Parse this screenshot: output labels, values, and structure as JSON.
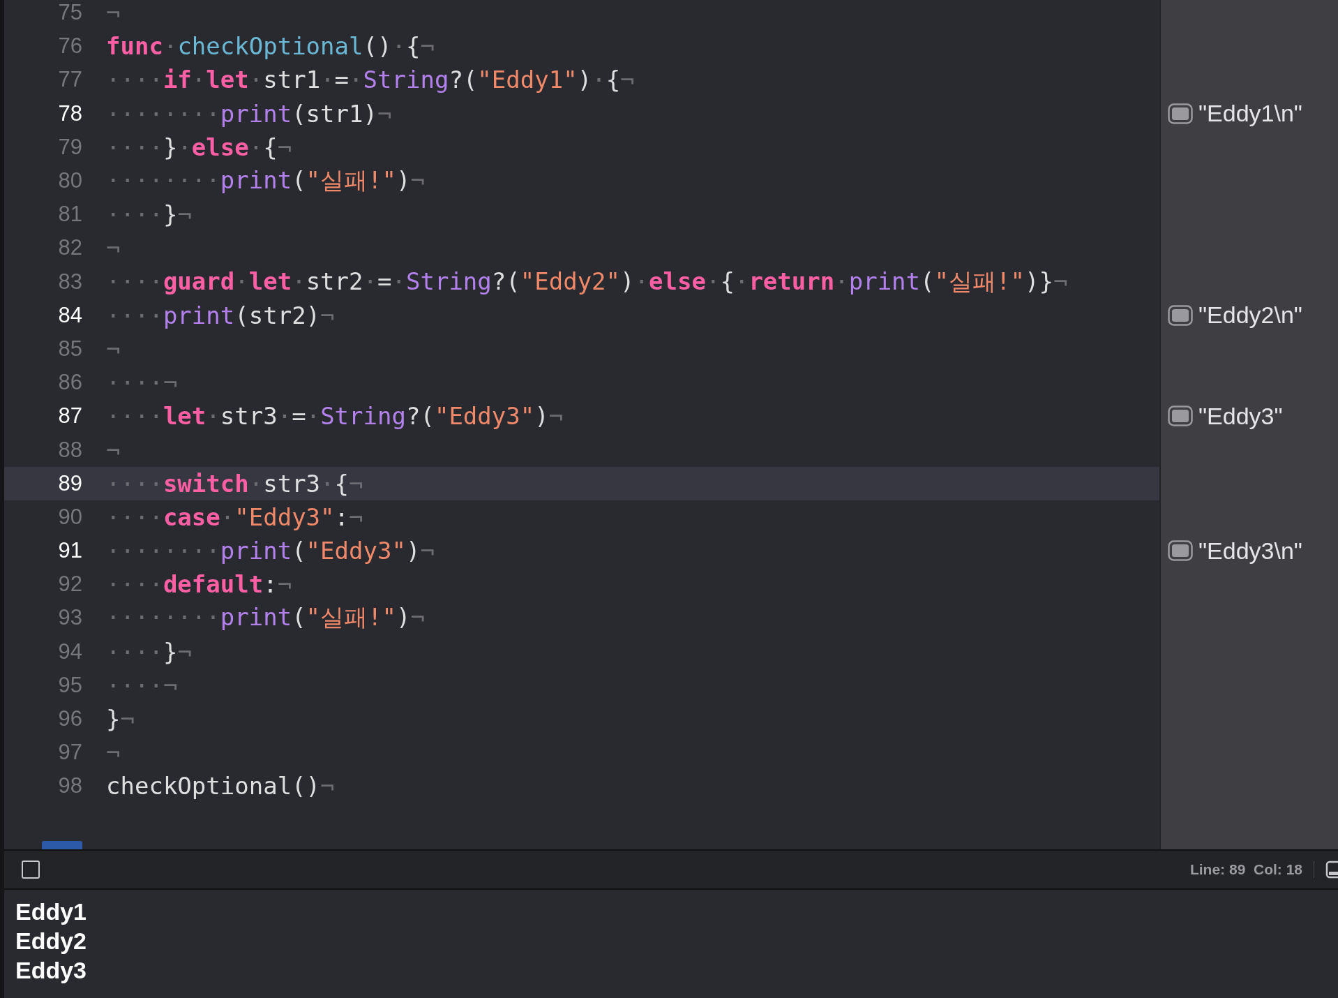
{
  "editor": {
    "lines": [
      {
        "number": "75",
        "emphasized": false,
        "selected": false,
        "tokens": [
          {
            "kind": "ws",
            "text": "¬"
          }
        ]
      },
      {
        "number": "76",
        "emphasized": false,
        "selected": false,
        "tokens": [
          {
            "kind": "kw",
            "text": "func"
          },
          {
            "kind": "ws",
            "text": "·"
          },
          {
            "kind": "decl",
            "text": "checkOptional"
          },
          {
            "kind": "plain",
            "text": "()"
          },
          {
            "kind": "ws",
            "text": "·"
          },
          {
            "kind": "plain",
            "text": "{"
          },
          {
            "kind": "ws",
            "text": "¬"
          }
        ]
      },
      {
        "number": "77",
        "emphasized": false,
        "selected": false,
        "tokens": [
          {
            "kind": "ws",
            "text": "····"
          },
          {
            "kind": "kw",
            "text": "if"
          },
          {
            "kind": "ws",
            "text": "·"
          },
          {
            "kind": "kw",
            "text": "let"
          },
          {
            "kind": "ws",
            "text": "·"
          },
          {
            "kind": "plain",
            "text": "str1"
          },
          {
            "kind": "ws",
            "text": "·"
          },
          {
            "kind": "plain",
            "text": "="
          },
          {
            "kind": "ws",
            "text": "·"
          },
          {
            "kind": "call",
            "text": "String"
          },
          {
            "kind": "plain",
            "text": "?("
          },
          {
            "kind": "str",
            "text": "\"Eddy1\""
          },
          {
            "kind": "plain",
            "text": ")"
          },
          {
            "kind": "ws",
            "text": "·"
          },
          {
            "kind": "plain",
            "text": "{"
          },
          {
            "kind": "ws",
            "text": "¬"
          }
        ]
      },
      {
        "number": "78",
        "emphasized": true,
        "selected": false,
        "result": "\"Eddy1\\n\"",
        "tokens": [
          {
            "kind": "ws",
            "text": "········"
          },
          {
            "kind": "call",
            "text": "print"
          },
          {
            "kind": "plain",
            "text": "(str1)"
          },
          {
            "kind": "ws",
            "text": "¬"
          }
        ]
      },
      {
        "number": "79",
        "emphasized": false,
        "selected": false,
        "tokens": [
          {
            "kind": "ws",
            "text": "····"
          },
          {
            "kind": "plain",
            "text": "}"
          },
          {
            "kind": "ws",
            "text": "·"
          },
          {
            "kind": "kw",
            "text": "else"
          },
          {
            "kind": "ws",
            "text": "·"
          },
          {
            "kind": "plain",
            "text": "{"
          },
          {
            "kind": "ws",
            "text": "¬"
          }
        ]
      },
      {
        "number": "80",
        "emphasized": false,
        "selected": false,
        "tokens": [
          {
            "kind": "ws",
            "text": "········"
          },
          {
            "kind": "call",
            "text": "print"
          },
          {
            "kind": "plain",
            "text": "("
          },
          {
            "kind": "str",
            "text": "\"실패!\""
          },
          {
            "kind": "plain",
            "text": ")"
          },
          {
            "kind": "ws",
            "text": "¬"
          }
        ]
      },
      {
        "number": "81",
        "emphasized": false,
        "selected": false,
        "tokens": [
          {
            "kind": "ws",
            "text": "····"
          },
          {
            "kind": "plain",
            "text": "}"
          },
          {
            "kind": "ws",
            "text": "¬"
          }
        ]
      },
      {
        "number": "82",
        "emphasized": false,
        "selected": false,
        "tokens": [
          {
            "kind": "ws",
            "text": "¬"
          }
        ]
      },
      {
        "number": "83",
        "emphasized": false,
        "selected": false,
        "tokens": [
          {
            "kind": "ws",
            "text": "····"
          },
          {
            "kind": "kw",
            "text": "guard"
          },
          {
            "kind": "ws",
            "text": "·"
          },
          {
            "kind": "kw",
            "text": "let"
          },
          {
            "kind": "ws",
            "text": "·"
          },
          {
            "kind": "plain",
            "text": "str2"
          },
          {
            "kind": "ws",
            "text": "·"
          },
          {
            "kind": "plain",
            "text": "="
          },
          {
            "kind": "ws",
            "text": "·"
          },
          {
            "kind": "call",
            "text": "String"
          },
          {
            "kind": "plain",
            "text": "?("
          },
          {
            "kind": "str",
            "text": "\"Eddy2\""
          },
          {
            "kind": "plain",
            "text": ")"
          },
          {
            "kind": "ws",
            "text": "·"
          },
          {
            "kind": "kw",
            "text": "else"
          },
          {
            "kind": "ws",
            "text": "·"
          },
          {
            "kind": "plain",
            "text": "{"
          },
          {
            "kind": "ws",
            "text": "·"
          },
          {
            "kind": "kw",
            "text": "return"
          },
          {
            "kind": "ws",
            "text": "·"
          },
          {
            "kind": "call",
            "text": "print"
          },
          {
            "kind": "plain",
            "text": "("
          },
          {
            "kind": "str",
            "text": "\"실패!\""
          },
          {
            "kind": "plain",
            "text": ")}"
          },
          {
            "kind": "ws",
            "text": "¬"
          }
        ]
      },
      {
        "number": "84",
        "emphasized": true,
        "selected": false,
        "result": "\"Eddy2\\n\"",
        "tokens": [
          {
            "kind": "ws",
            "text": "····"
          },
          {
            "kind": "call",
            "text": "print"
          },
          {
            "kind": "plain",
            "text": "(str2)"
          },
          {
            "kind": "ws",
            "text": "¬"
          }
        ]
      },
      {
        "number": "85",
        "emphasized": false,
        "selected": false,
        "tokens": [
          {
            "kind": "ws",
            "text": "¬"
          }
        ]
      },
      {
        "number": "86",
        "emphasized": false,
        "selected": false,
        "tokens": [
          {
            "kind": "ws",
            "text": "····¬"
          }
        ]
      },
      {
        "number": "87",
        "emphasized": true,
        "selected": false,
        "result": "\"Eddy3\"",
        "tokens": [
          {
            "kind": "ws",
            "text": "····"
          },
          {
            "kind": "kw",
            "text": "let"
          },
          {
            "kind": "ws",
            "text": "·"
          },
          {
            "kind": "plain",
            "text": "str3"
          },
          {
            "kind": "ws",
            "text": "·"
          },
          {
            "kind": "plain",
            "text": "="
          },
          {
            "kind": "ws",
            "text": "·"
          },
          {
            "kind": "call",
            "text": "String"
          },
          {
            "kind": "plain",
            "text": "?("
          },
          {
            "kind": "str",
            "text": "\"Eddy3\""
          },
          {
            "kind": "plain",
            "text": ")"
          },
          {
            "kind": "ws",
            "text": "¬"
          }
        ]
      },
      {
        "number": "88",
        "emphasized": false,
        "selected": false,
        "tokens": [
          {
            "kind": "ws",
            "text": "¬"
          }
        ]
      },
      {
        "number": "89",
        "emphasized": true,
        "selected": true,
        "tokens": [
          {
            "kind": "ws",
            "text": "····"
          },
          {
            "kind": "kw",
            "text": "switch"
          },
          {
            "kind": "ws",
            "text": "·"
          },
          {
            "kind": "plain",
            "text": "str3"
          },
          {
            "kind": "ws",
            "text": "·"
          },
          {
            "kind": "plain",
            "text": "{"
          },
          {
            "kind": "ws",
            "text": "¬"
          }
        ]
      },
      {
        "number": "90",
        "emphasized": false,
        "selected": false,
        "tokens": [
          {
            "kind": "ws",
            "text": "····"
          },
          {
            "kind": "kw",
            "text": "case"
          },
          {
            "kind": "ws",
            "text": "·"
          },
          {
            "kind": "str",
            "text": "\"Eddy3\""
          },
          {
            "kind": "plain",
            "text": ":"
          },
          {
            "kind": "ws",
            "text": "¬"
          }
        ]
      },
      {
        "number": "91",
        "emphasized": true,
        "selected": false,
        "result": "\"Eddy3\\n\"",
        "tokens": [
          {
            "kind": "ws",
            "text": "········"
          },
          {
            "kind": "call",
            "text": "print"
          },
          {
            "kind": "plain",
            "text": "("
          },
          {
            "kind": "str",
            "text": "\"Eddy3\""
          },
          {
            "kind": "plain",
            "text": ")"
          },
          {
            "kind": "ws",
            "text": "¬"
          }
        ]
      },
      {
        "number": "92",
        "emphasized": false,
        "selected": false,
        "tokens": [
          {
            "kind": "ws",
            "text": "····"
          },
          {
            "kind": "kw",
            "text": "default"
          },
          {
            "kind": "plain",
            "text": ":"
          },
          {
            "kind": "ws",
            "text": "¬"
          }
        ]
      },
      {
        "number": "93",
        "emphasized": false,
        "selected": false,
        "tokens": [
          {
            "kind": "ws",
            "text": "········"
          },
          {
            "kind": "call",
            "text": "print"
          },
          {
            "kind": "plain",
            "text": "("
          },
          {
            "kind": "str",
            "text": "\"실패!\""
          },
          {
            "kind": "plain",
            "text": ")"
          },
          {
            "kind": "ws",
            "text": "¬"
          }
        ]
      },
      {
        "number": "94",
        "emphasized": false,
        "selected": false,
        "tokens": [
          {
            "kind": "ws",
            "text": "····"
          },
          {
            "kind": "plain",
            "text": "}"
          },
          {
            "kind": "ws",
            "text": "¬"
          }
        ]
      },
      {
        "number": "95",
        "emphasized": false,
        "selected": false,
        "tokens": [
          {
            "kind": "ws",
            "text": "····¬"
          }
        ]
      },
      {
        "number": "96",
        "emphasized": false,
        "selected": false,
        "tokens": [
          {
            "kind": "plain",
            "text": "}"
          },
          {
            "kind": "ws",
            "text": "¬"
          }
        ]
      },
      {
        "number": "97",
        "emphasized": false,
        "selected": false,
        "tokens": [
          {
            "kind": "ws",
            "text": "¬"
          }
        ]
      },
      {
        "number": "98",
        "emphasized": false,
        "selected": false,
        "tokens": [
          {
            "kind": "plain",
            "text": "checkOptional()"
          },
          {
            "kind": "ws",
            "text": "¬"
          }
        ]
      }
    ]
  },
  "status_bar": {
    "cursor_position": "Line: 89  Col: 18"
  },
  "console": {
    "lines": [
      "Eddy1",
      "Eddy2",
      "Eddy3"
    ]
  }
}
